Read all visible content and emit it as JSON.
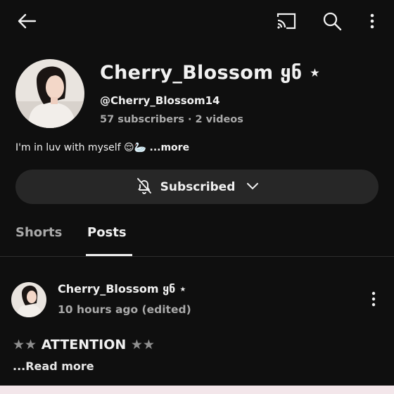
{
  "header": {
    "back_icon": "arrow-left-icon",
    "cast_icon": "cast-icon",
    "search_icon": "search-icon",
    "menu_icon": "more-vertical-icon"
  },
  "channel": {
    "name": "Cherry_Blossom ყნ ⋆",
    "handle": "@Cherry_Blossom14",
    "stats": "57 subscribers · 2 videos",
    "bio": "I'm in luv with myself 😌🦢 ",
    "bio_more": "...more",
    "subscribe_label": "Subscribed"
  },
  "tabs": [
    {
      "label": "Shorts"
    },
    {
      "label": "Posts"
    }
  ],
  "post": {
    "author": "Cherry_Blossom ყნ ⋆",
    "time": "10 hours ago (edited)",
    "stars": "★★",
    "headline": " ATTENTION ",
    "read_more": "...Read more"
  },
  "colors": {
    "background": "#0f0f0f",
    "button": "#272727",
    "secondary_text": "#aaaaaa"
  }
}
